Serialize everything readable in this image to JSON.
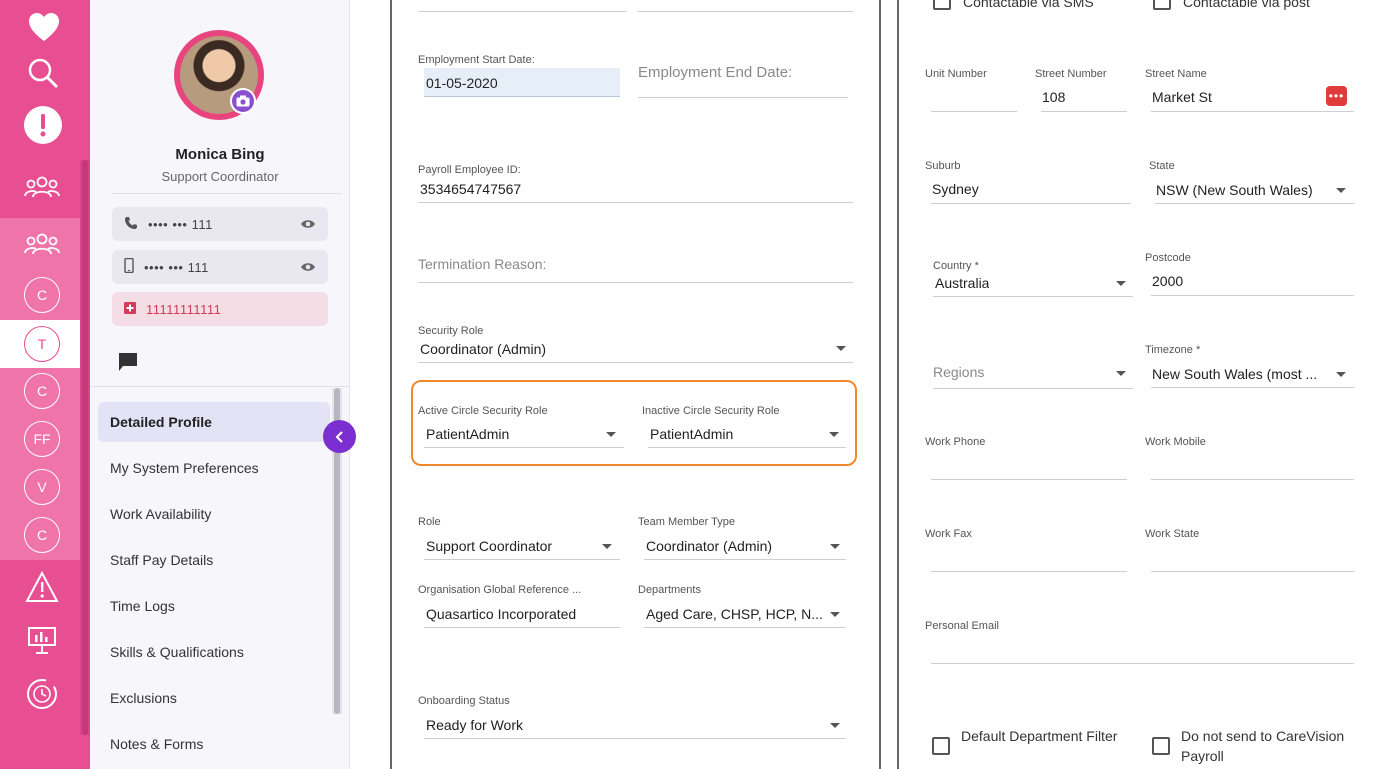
{
  "rail": {
    "circles": [
      "C",
      "T",
      "C",
      "FF",
      "V",
      "C"
    ]
  },
  "profile": {
    "name": "Monica Bing",
    "role": "Support Coordinator",
    "phone": "•••• ••• 111",
    "mobile": "•••• ••• 111",
    "medical": "11111111111"
  },
  "nav": {
    "items": [
      "Detailed Profile",
      "My System Preferences",
      "Work Availability",
      "Staff Pay Details",
      "Time Logs",
      "Skills & Qualifications",
      "Exclusions",
      "Notes & Forms"
    ]
  },
  "form_left": {
    "emp_start_label": "Employment Start Date:",
    "emp_start_value": "01-05-2020",
    "emp_end_placeholder": "Employment End Date:",
    "payroll_label": "Payroll Employee ID:",
    "payroll_value": "3534654747567",
    "termination_placeholder": "Termination Reason:",
    "security_role_label": "Security Role",
    "security_role_value": "Coordinator (Admin)",
    "active_circle_label": "Active Circle Security Role",
    "active_circle_value": "PatientAdmin",
    "inactive_circle_label": "Inactive Circle Security Role",
    "inactive_circle_value": "PatientAdmin",
    "role_label": "Role",
    "role_value": "Support Coordinator",
    "team_type_label": "Team Member Type",
    "team_type_value": "Coordinator (Admin)",
    "org_ref_label": "Organisation Global Reference ...",
    "org_ref_value": "Quasartico Incorporated",
    "departments_label": "Departments",
    "departments_value": "Aged Care, CHSP, HCP, N...",
    "onboarding_label": "Onboarding Status",
    "onboarding_value": "Ready for Work"
  },
  "form_right": {
    "sms_label": "Contactable via SMS",
    "post_label": "Contactable via post",
    "unit_label": "Unit Number",
    "street_no_label": "Street Number",
    "street_no_value": "108",
    "street_name_label": "Street Name",
    "street_name_value": "Market St",
    "suburb_label": "Suburb",
    "suburb_value": "Sydney",
    "state_label": "State",
    "state_value": "NSW (New South Wales)",
    "country_label": "Country *",
    "country_value": "Australia",
    "postcode_label": "Postcode",
    "postcode_value": "2000",
    "regions_placeholder": "Regions",
    "timezone_label": "Timezone *",
    "timezone_value": "New South Wales (most ...",
    "work_phone_label": "Work Phone",
    "work_mobile_label": "Work Mobile",
    "work_fax_label": "Work Fax",
    "work_state_label": "Work State",
    "personal_email_label": "Personal Email",
    "default_dept_label": "Default Department Filter",
    "no_payroll_label": "Do not send to CareVision Payroll"
  }
}
